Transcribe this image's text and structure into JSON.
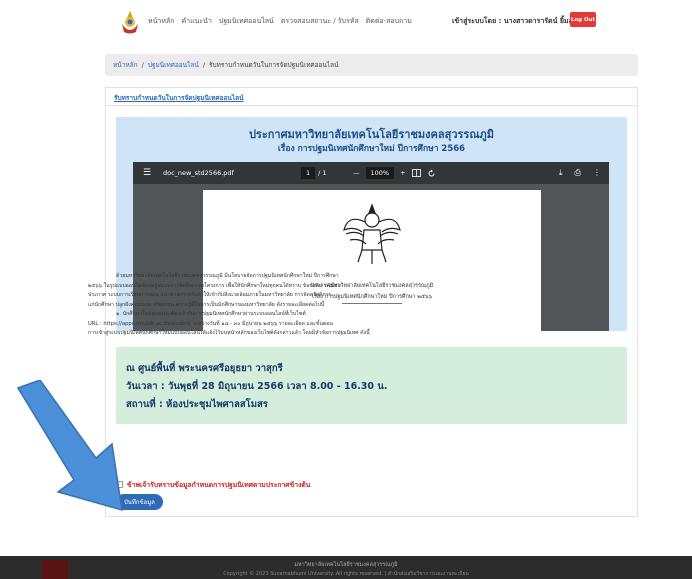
{
  "nav": {
    "links": [
      "หน้าหลัก",
      "คำแนะนำ",
      "ปฐมนิเทศออนไลน์",
      "ตรวจสอบสถานะ / รับรหัส",
      "ติดต่อ-สอบถาม"
    ],
    "user_label": "เข้าสู่ระบบโดย : นางสาวดารารัตน์ ยิ้มละมัย",
    "logout_label": "Log Out"
  },
  "breadcrumb": {
    "home": "หน้าหลัก",
    "sep1": "/",
    "section": "ปฐมนิเทศออนไลน์",
    "sep2": "/",
    "current": "รับทราบกำหนดวันในการจัดปฐมนิเทศออนไลน์"
  },
  "card": {
    "header": "รับทราบกำหนดวันในการจัดปฐมนิเทศออนไลน์",
    "announcement_title": "ประกาศมหาวิทยาลัยเทคโนโลยีราชมงคลสุวรรณภูมิ",
    "announcement_subtitle": "เรื่อง การปฐมนิเทศนักศึกษาใหม่ ปีการศึกษา 2566"
  },
  "pdf": {
    "menu_icon": "☰",
    "filename": "doc_new_std2566.pdf",
    "page_current": "1",
    "page_total": "/ 1",
    "zoom_minus": "—",
    "zoom_value": "100%",
    "zoom_plus": "+",
    "download_icon": "⤓",
    "print_icon": "⎙",
    "more_icon": "⋮",
    "doc_line1": "ประกาศมหาวิทยาลัยเทคโนโลยีราชมงคลสุวรรณภูมิ",
    "doc_line2": "เรื่อง การปฐมนิเทศนักศึกษาใหม่ ปีการศึกษา ๒๕๖๖",
    "doc_para": [
      "ด้วยมหาวิทยาลัยเทคโนโลยีราชมงคลสุวรรณภูมิ มีนโยบายจัดการปฐมนิเทศนักศึกษาใหม่ ปีการศึกษา",
      "๒๕๖๖ ในรูปแบบออนไลน์ผสมรูปแบบการจัดกิจกรรมโครงการ เพื่อให้นักศึกษาใหม่ทุกคนได้ทราบ ข้อบังคับ ระเบียบ",
      "ประกาศ ระบบการเรียนการสอน แนวทางการปรับตัวให้เข้ากับสิ่งแวดล้อมภายในมหาวิทยาลัย การจัดสวัสดิการ",
      "แก่นักศึกษา ปลูกฝังคุณธรรม จริยธรรม ความรู้ดีในการเป็นนักศึกษาของมหาวิทยาลัย ดังรายละเอียดต่อไปนี้",
      "๑. นักศึกษาใหม่ทุกคนจะต้องเข้ารับการปฐมนิเทศนักศึกษาผ่านระบบออนไลน์ที่เว็บไซต์",
      "URL : https://apps.rmutsb.ac.th/student ระหว่างวันที่ ๑๘ - ๓๐ มิถุนายน ๒๕๖๖ รายละเอียด และขั้นตอน",
      "การเข้าสู่ระบบปฐมนิเทศนักศึกษาใหม่แบบออนไลน์ได้แจ้งไว้บนหน้าหลักของเว็บไซต์ดังกล่าวแล้ว โดยมีหัวข้อการปฐมนิเทศ ดังนี้"
    ]
  },
  "info": {
    "place": "ณ ศูนย์พื้นที่ พระนครศรีอยุธยา วาสุกรี",
    "datetime": "วันเวลา : วันพุธที่ 28 มิถุนายน 2566 เวลา 8.00 - 16.30 น.",
    "venue": "สถานที่ : ห้องประชุมไพศาลสโมสร"
  },
  "accept_label": "ข้าพเจ้ารับทราบข้อมูลกำหนดการปฐมนิเทศตามประกาศข้างต้น",
  "save_label": "บันทึกข้อมูล",
  "footer": {
    "line1": "มหาวิทยาลัยเทคโนโลยีราชมงคลสุวรรณภูมิ",
    "line2": "Copyright © 2023 Suvarnabhumi University. All rights reserved. | สำนักส่งเสริมวิชาการและงานทะเบียน"
  },
  "colors": {
    "accent": "#2d6bb6",
    "logout": "#e53935",
    "info_bg": "#d5eedb",
    "announce_bg": "#cfe4f6",
    "arrow": "#4a8fd8"
  }
}
